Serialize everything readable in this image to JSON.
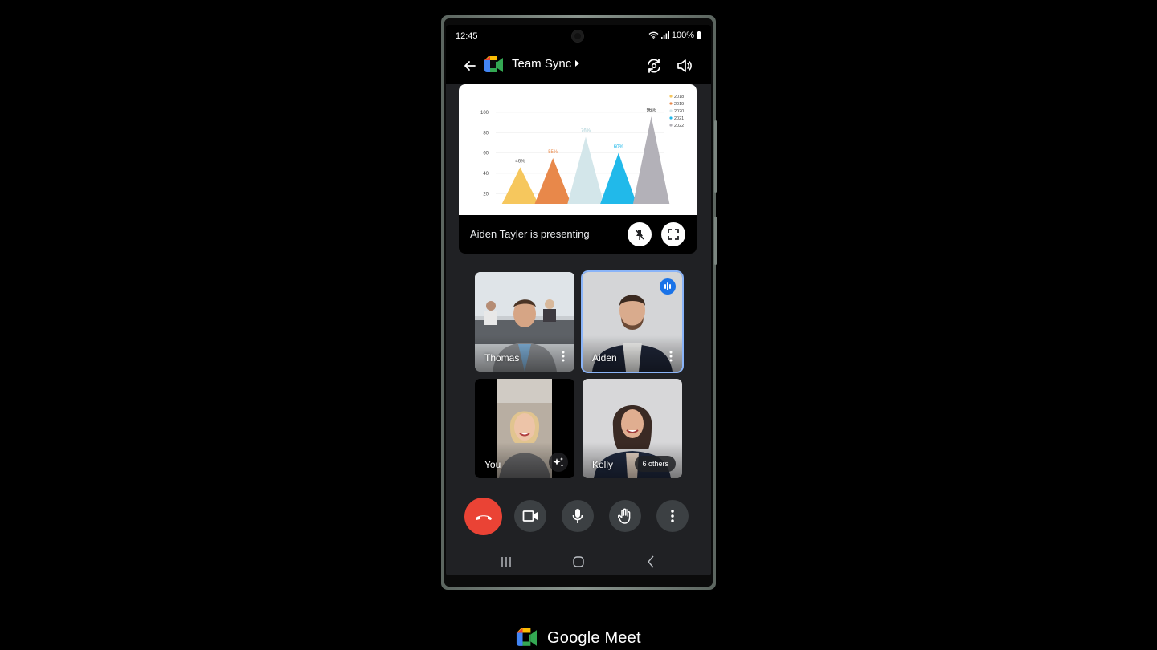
{
  "status_bar": {
    "time": "12:45",
    "battery": "100%"
  },
  "app_bar": {
    "title": "Team Sync",
    "back_icon": "arrow-left-icon",
    "switch_camera_icon": "switch-camera-icon",
    "speaker_icon": "speaker-icon"
  },
  "presentation": {
    "presenter_text": "Aiden Tayler is presenting",
    "unpin_icon": "unpin-icon",
    "fullscreen_icon": "fullscreen-icon"
  },
  "chart_data": {
    "type": "bar",
    "mark_shape": "triangle",
    "categories": [
      "2018",
      "2019",
      "2020",
      "2021",
      "2022"
    ],
    "values": [
      46,
      55,
      76,
      60,
      96
    ],
    "data_labels": [
      "46%",
      "55%",
      "76%",
      "60%",
      "96%"
    ],
    "colors": [
      "#f6c75d",
      "#e8884a",
      "#d3e6ea",
      "#21b9ea",
      "#b3b1b8"
    ],
    "label_colors": [
      "#555555",
      "#e8884a",
      "#a9cfd6",
      "#21b9ea",
      "#333333"
    ],
    "yticks": [
      20,
      40,
      60,
      80,
      100
    ],
    "ylim": [
      10,
      100
    ],
    "legend": [
      "2018",
      "2019",
      "2020",
      "2021",
      "2022"
    ],
    "legend_position": "top-right",
    "grid": true,
    "title": "",
    "xlabel": "",
    "ylabel": ""
  },
  "participants": [
    {
      "name": "Thomas",
      "speaking": false,
      "badge": ""
    },
    {
      "name": "Aiden",
      "speaking": true,
      "badge": ""
    },
    {
      "name": "You",
      "speaking": false,
      "badge": ""
    },
    {
      "name": "Kelly",
      "speaking": false,
      "badge": "6 others"
    }
  ],
  "controls": {
    "end_call": "end-call",
    "camera": "camera",
    "microphone": "microphone",
    "raise_hand": "raise-hand",
    "more": "more-options"
  },
  "colors": {
    "end_call": "#ea4335",
    "active_speaker": "#8ab4f8",
    "speaking_badge": "#1a73e8",
    "control_bg": "#3c4043"
  },
  "brand": {
    "name": "Google Meet"
  }
}
